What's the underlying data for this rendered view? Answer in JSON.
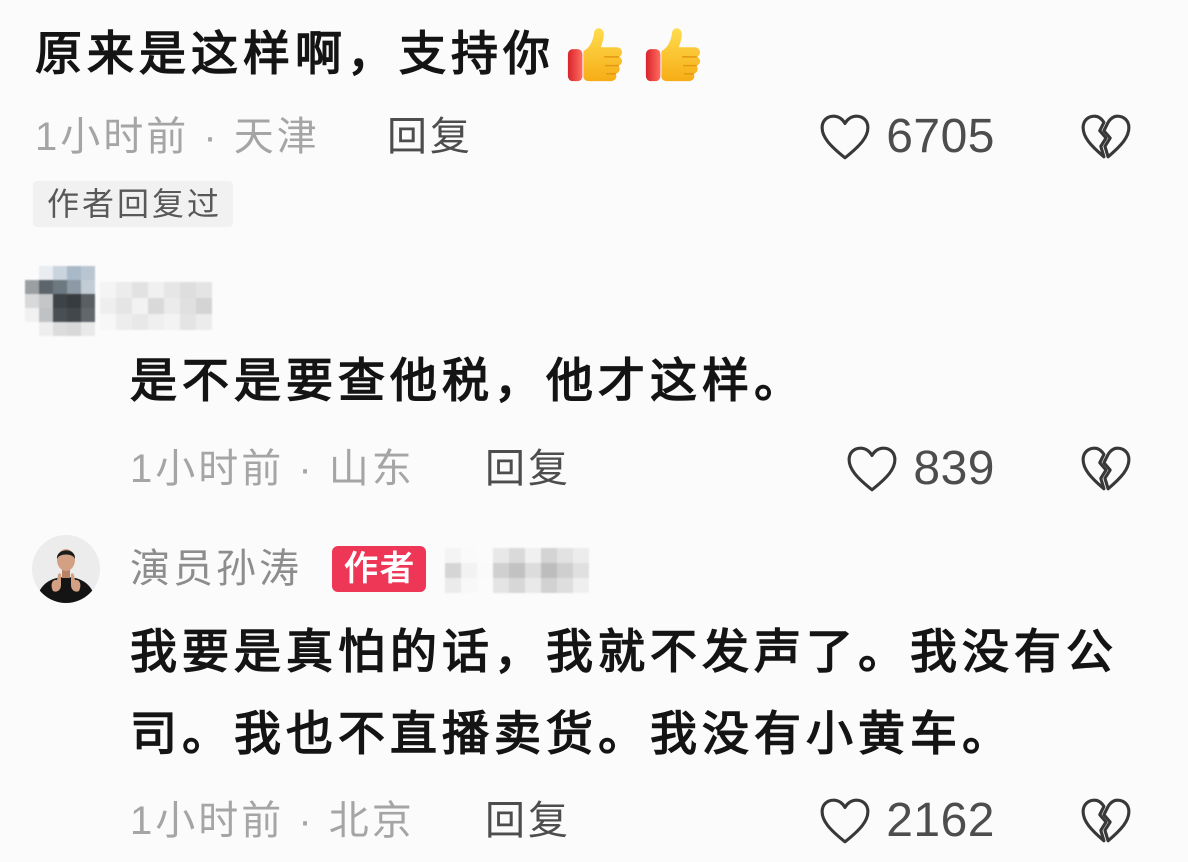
{
  "colors": {
    "background": "#fbfbfb",
    "primary_text": "#141414",
    "meta_text": "#a5a5a5",
    "username_text": "#8d8d8d",
    "action_text": "#4d4d4d",
    "icon_stroke": "#383838",
    "badge_bg": "#f1f1f1",
    "badge_text": "#585858",
    "author_badge_bg": "#ee3656",
    "author_badge_text": "#ffffff"
  },
  "icons": {
    "like": "heart-icon",
    "dislike": "broken-heart-icon",
    "emoji": "thumbs-up-icon"
  },
  "comment": {
    "text": "原来是这样啊，支持你",
    "emojis": [
      "thumbs-up",
      "thumbs-up"
    ],
    "meta": "1小时前 · 天津",
    "reply_label": "回复",
    "likes": "6705",
    "badge": "作者回复过"
  },
  "replies": [
    {
      "text": "是不是要查他税，他才这样。",
      "meta": "1小时前 · 山东",
      "reply_label": "回复",
      "likes": "839"
    },
    {
      "author": "演员孙涛",
      "author_badge": "作者",
      "text": "我要是真怕的话，我就不发声了。我没有公司。我也不直播卖货。我没有小黄车。",
      "meta": "1小时前 · 北京",
      "reply_label": "回复",
      "likes": "2162"
    }
  ]
}
